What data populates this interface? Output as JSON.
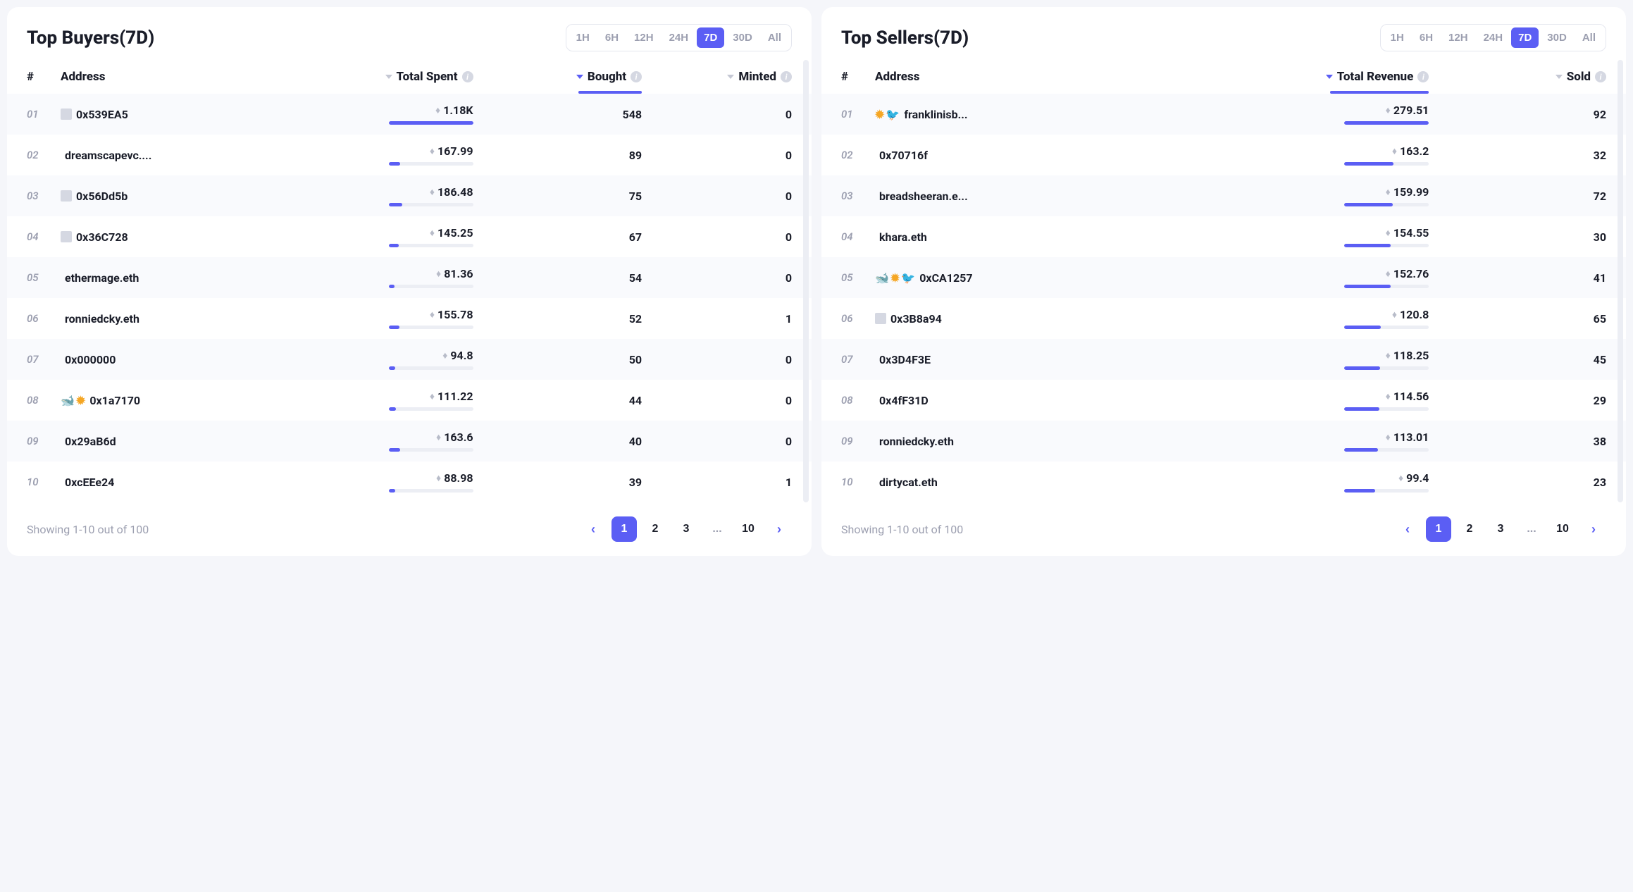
{
  "time_filters": [
    "1H",
    "6H",
    "12H",
    "24H",
    "7D",
    "30D",
    "All"
  ],
  "active_filter": "7D",
  "buyers": {
    "title": "Top Buyers(7D)",
    "columns": {
      "rank": "#",
      "address": "Address",
      "spent": "Total Spent",
      "bought": "Bought",
      "minted": "Minted"
    },
    "sorted_by": "bought",
    "rows": [
      {
        "rank": "01",
        "badges": [
          "doc"
        ],
        "address": "0x539EA5",
        "spent": "1.18K",
        "bar": 100,
        "bought": "548",
        "minted": "0"
      },
      {
        "rank": "02",
        "badges": [],
        "address": "dreamscapevc....",
        "spent": "167.99",
        "bar": 14,
        "bought": "89",
        "minted": "0"
      },
      {
        "rank": "03",
        "badges": [
          "doc"
        ],
        "address": "0x56Dd5b",
        "spent": "186.48",
        "bar": 16,
        "bought": "75",
        "minted": "0"
      },
      {
        "rank": "04",
        "badges": [
          "doc"
        ],
        "address": "0x36C728",
        "spent": "145.25",
        "bar": 12,
        "bought": "67",
        "minted": "0"
      },
      {
        "rank": "05",
        "badges": [],
        "address": "ethermage.eth",
        "spent": "81.36",
        "bar": 7,
        "bought": "54",
        "minted": "0"
      },
      {
        "rank": "06",
        "badges": [],
        "address": "ronniedcky.eth",
        "spent": "155.78",
        "bar": 13,
        "bought": "52",
        "minted": "1"
      },
      {
        "rank": "07",
        "badges": [],
        "address": "0x000000",
        "spent": "94.8",
        "bar": 8,
        "bought": "50",
        "minted": "0"
      },
      {
        "rank": "08",
        "badges": [
          "whale",
          "sun"
        ],
        "address": "0x1a7170",
        "spent": "111.22",
        "bar": 9,
        "bought": "44",
        "minted": "0"
      },
      {
        "rank": "09",
        "badges": [],
        "address": "0x29aB6d",
        "spent": "163.6",
        "bar": 14,
        "bought": "40",
        "minted": "0"
      },
      {
        "rank": "10",
        "badges": [],
        "address": "0xcEEe24",
        "spent": "88.98",
        "bar": 8,
        "bought": "39",
        "minted": "1"
      }
    ],
    "showing": "Showing 1-10 out of 100",
    "pages": [
      "1",
      "2",
      "3",
      "...",
      "10"
    ]
  },
  "sellers": {
    "title": "Top Sellers(7D)",
    "columns": {
      "rank": "#",
      "address": "Address",
      "revenue": "Total Revenue",
      "sold": "Sold"
    },
    "sorted_by": "revenue",
    "rows": [
      {
        "rank": "01",
        "badges": [
          "sun",
          "bird"
        ],
        "address": "franklinisb...",
        "revenue": "279.51",
        "bar": 100,
        "sold": "92"
      },
      {
        "rank": "02",
        "badges": [],
        "address": "0x70716f",
        "revenue": "163.2",
        "bar": 58,
        "sold": "32"
      },
      {
        "rank": "03",
        "badges": [],
        "address": "breadsheeran.e...",
        "revenue": "159.99",
        "bar": 57,
        "sold": "72"
      },
      {
        "rank": "04",
        "badges": [],
        "address": "khara.eth",
        "revenue": "154.55",
        "bar": 55,
        "sold": "30"
      },
      {
        "rank": "05",
        "badges": [
          "whale",
          "sun",
          "bird"
        ],
        "address": "0xCA1257",
        "revenue": "152.76",
        "bar": 55,
        "sold": "41"
      },
      {
        "rank": "06",
        "badges": [
          "doc"
        ],
        "address": "0x3B8a94",
        "revenue": "120.8",
        "bar": 43,
        "sold": "65"
      },
      {
        "rank": "07",
        "badges": [],
        "address": "0x3D4F3E",
        "revenue": "118.25",
        "bar": 42,
        "sold": "45"
      },
      {
        "rank": "08",
        "badges": [],
        "address": "0x4fF31D",
        "revenue": "114.56",
        "bar": 41,
        "sold": "29"
      },
      {
        "rank": "09",
        "badges": [],
        "address": "ronniedcky.eth",
        "revenue": "113.01",
        "bar": 40,
        "sold": "38"
      },
      {
        "rank": "10",
        "badges": [],
        "address": "dirtycat.eth",
        "revenue": "99.4",
        "bar": 36,
        "sold": "23"
      }
    ],
    "showing": "Showing 1-10 out of 100",
    "pages": [
      "1",
      "2",
      "3",
      "...",
      "10"
    ]
  }
}
